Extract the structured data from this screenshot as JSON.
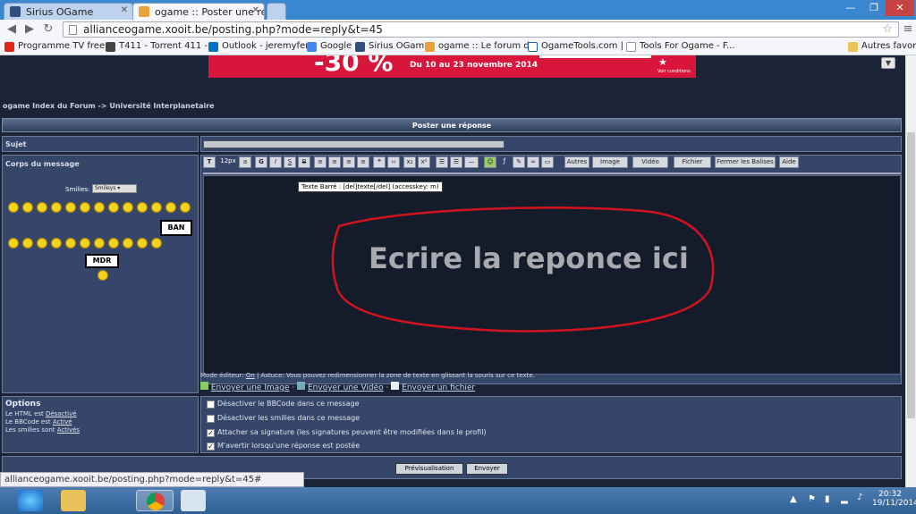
{
  "browser": {
    "tabs": [
      {
        "title": "Sirius OGame",
        "active": false
      },
      {
        "title": "ogame :: Poster une répo",
        "active": true
      }
    ],
    "url": "allianceogame.xooit.be/posting.php?mode=reply&t=45",
    "status_url": "allianceogame.xooit.be/posting.php?mode=reply&t=45#",
    "bookmarks": [
      "Programme TV free ...",
      "T411 - Torrent 411 - ...",
      "Outlook - jeremyfer...",
      "Google",
      "Sirius OGame",
      "ogame :: Le forum d...",
      "OgameTools.com | ...",
      "Tools For Ogame - F..."
    ],
    "other_bookmarks": "Autres favoris"
  },
  "banner": {
    "promo": "-30 %",
    "dates": "Du 10 au 23 novembre 2014",
    "link": "Voir conditions"
  },
  "forum": {
    "breadcrumb": "ogame Index du Forum -> Université Interplanetaire",
    "section_title": "Poster une réponse",
    "subject_label": "Sujet",
    "body_label": "Corps du message",
    "smilies_label": "Smilies:",
    "smilies_select": "Smileys",
    "ban_sign": "BAN",
    "mdr_sign": "MDR",
    "toolbar": {
      "font": "T",
      "size": "12px",
      "size_icon": "a",
      "bold": "G",
      "italic": "I",
      "underline": "S",
      "strike": "B",
      "autres": "Autres",
      "image": "Image",
      "video": "Vidéo",
      "fichier": "Fichier",
      "fermer": "Fermer les Balises",
      "aide": "Aide"
    },
    "tooltip": "Texte Barré : [del]texte[/del] (accesskey: m)",
    "message_annotation": "Ecrire la reponce ici",
    "editor_mode_label": "Mode éditeur:",
    "editor_mode_value": "On",
    "editor_tip": "| Astuce: Vous pouvez redimensionner la zone de texte en glissant la souris sur ce texte.",
    "upload_image": "Envoyer une Image",
    "upload_video": "Envoyer une Vidéo",
    "upload_file": "Envoyer un fichier",
    "options_title": "Options",
    "html_label": "Le HTML est",
    "html_state": "Désactivé",
    "bbcode_label": "Le BBCode est",
    "bbcode_state": "Activé",
    "smilies_state_label": "Les smilies sont",
    "smilies_state": "Activés",
    "options": [
      {
        "label": "Désactiver le BBCode dans ce message",
        "checked": false
      },
      {
        "label": "Désactiver les smilies dans ce message",
        "checked": false
      },
      {
        "label": "Attacher sa signature (les signatures peuvent être modifiées dans le profil)",
        "checked": true
      },
      {
        "label": "M'avertir lorsqu'une réponse est postée",
        "checked": true
      }
    ],
    "preview_button": "Prévisualisation",
    "send_button": "Envoyer"
  },
  "taskbar": {
    "time": "20:32",
    "date": "19/11/2014"
  },
  "colors": {
    "page_bg": "#1b2436",
    "annotation": "#d2121d",
    "chrome_tabstrip": "#3a86cf"
  }
}
